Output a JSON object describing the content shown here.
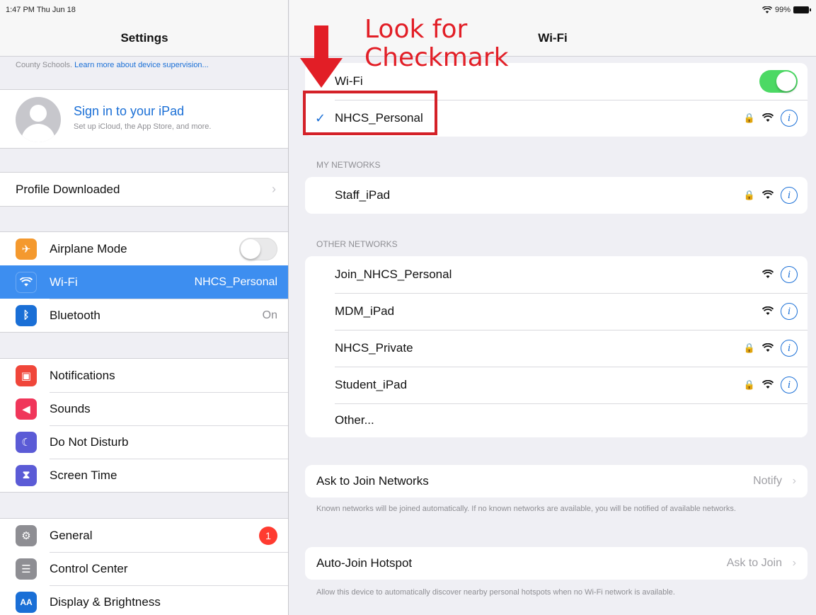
{
  "status_bar": {
    "time": "1:47 PM  Thu Jun 18",
    "battery": "99%"
  },
  "sidebar": {
    "title": "Settings",
    "supervision_text": "County Schools.",
    "supervision_link": "Learn more about device supervision...",
    "account": {
      "title": "Sign in to your iPad",
      "subtitle": "Set up iCloud, the App Store, and more."
    },
    "profile_row": "Profile Downloaded",
    "connectivity": [
      {
        "label": "Airplane Mode",
        "icon": "airplane-icon",
        "color": "#f4992e"
      },
      {
        "label": "Wi-Fi",
        "value": "NHCS_Personal",
        "icon": "wifi-icon",
        "color": "#3d8ef0"
      },
      {
        "label": "Bluetooth",
        "value": "On",
        "icon": "bluetooth-icon",
        "color": "#1a6fd6"
      }
    ],
    "notifications": [
      {
        "label": "Notifications",
        "icon": "notifications-icon",
        "color": "#f0463a"
      },
      {
        "label": "Sounds",
        "icon": "sounds-icon",
        "color": "#f0365a"
      },
      {
        "label": "Do Not Disturb",
        "icon": "moon-icon",
        "color": "#5b5bd6"
      },
      {
        "label": "Screen Time",
        "icon": "hourglass-icon",
        "color": "#5b5bd6"
      }
    ],
    "general": [
      {
        "label": "General",
        "badge": "1",
        "icon": "gear-icon",
        "color": "#8e8e93"
      },
      {
        "label": "Control Center",
        "icon": "control-center-icon",
        "color": "#8e8e93"
      },
      {
        "label": "Display & Brightness",
        "icon_text": "AA",
        "icon": "display-icon",
        "color": "#1a6fd6"
      }
    ]
  },
  "wifi": {
    "title": "Wi-Fi",
    "toggle_label": "Wi-Fi",
    "connected": "NHCS_Personal",
    "my_networks_header": "MY NETWORKS",
    "my_networks": [
      "Staff_iPad"
    ],
    "other_networks_header": "OTHER NETWORKS",
    "other_networks": [
      {
        "name": "Join_NHCS_Personal",
        "locked": false
      },
      {
        "name": "MDM_iPad",
        "locked": false
      },
      {
        "name": "NHCS_Private",
        "locked": true
      },
      {
        "name": "Student_iPad",
        "locked": true
      }
    ],
    "other_label": "Other...",
    "ask_to_join": {
      "label": "Ask to Join Networks",
      "value": "Notify",
      "note": "Known networks will be joined automatically. If no known networks are available, you will be notified of available networks."
    },
    "auto_join": {
      "label": "Auto-Join Hotspot",
      "value": "Ask to Join",
      "note": "Allow this device to automatically discover nearby personal hotspots when no Wi-Fi network is available."
    }
  },
  "annotation": {
    "line1": "Look for",
    "line2": "Checkmark",
    "color": "#e21e26"
  }
}
